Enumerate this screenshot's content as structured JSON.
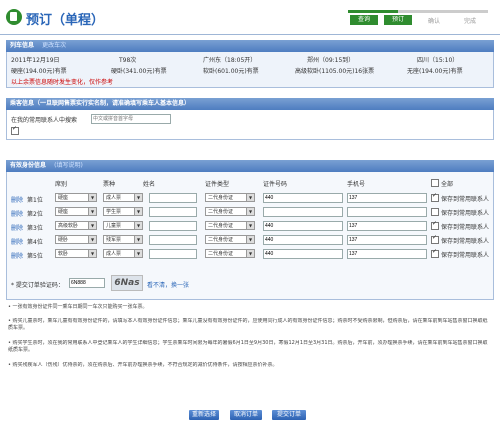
{
  "header": {
    "title": "预订（单程）",
    "steps": [
      "查询",
      "预订",
      "确认",
      "完成"
    ],
    "active_steps": 2
  },
  "train": {
    "section_title": "列车信息",
    "section_link": "更改车次",
    "date": "2011年12月19日",
    "train_no": "T98次",
    "from": "广州东（18:05开）",
    "via": "郑州（09:15到）",
    "to": "四川（15:10）",
    "seats": [
      "硬座(194.00元)有票",
      "硬卧(341.00元)有票",
      "软卧(601.00元)有票",
      "高级软卧(1105.00元)16张票",
      "无座(194.00元)有票"
    ],
    "note": "以上余票信息随时发生变化，仅作参考"
  },
  "search": {
    "section_title": "乘客信息（一旦联网售票实行实名制，请准确填写乘车人基本信息）",
    "label": "在我的常用联系人中搜索",
    "placeholder": "中文或拼音首字母"
  },
  "pass": {
    "section_title": "有效身份信息",
    "section_link": "(填写说明)",
    "columns": [
      "席别",
      "票种",
      "姓名",
      "证件类型",
      "证件号码",
      "手机号",
      "全部"
    ],
    "rows": [
      {
        "del": "删除",
        "pos": "第1位",
        "seat": "硬座",
        "ticket": "成人票",
        "idtype": "二代身份证",
        "idno": "440",
        "phone": "137",
        "save": "保存到常用联系人"
      },
      {
        "del": "删除",
        "pos": "第2位",
        "seat": "硬座",
        "ticket": "学生票",
        "idtype": "二代身份证",
        "idno": "",
        "phone": "",
        "save": "保存到常用联系人"
      },
      {
        "del": "删除",
        "pos": "第3位",
        "seat": "高级软卧",
        "ticket": "儿童票",
        "idtype": "二代身份证",
        "idno": "440",
        "phone": "137",
        "save": "保存到常用联系人"
      },
      {
        "del": "删除",
        "pos": "第4位",
        "seat": "硬卧",
        "ticket": "残军票",
        "idtype": "二代身份证",
        "idno": "440",
        "phone": "137",
        "save": "保存到常用联系人"
      },
      {
        "del": "删除",
        "pos": "第5位",
        "seat": "软卧",
        "ticket": "成人票",
        "idtype": "二代身份证",
        "idno": "440",
        "phone": "137",
        "save": "保存到常用联系人"
      }
    ],
    "captcha_label": "* 提交订单验证码：",
    "captcha_value": "6N888",
    "captcha_img": "6Nas",
    "captcha_link": "看不清，换一张"
  },
  "notes": [
    "• 一张有效身份证件同一乘车日期同一车次只能购买一张车票。",
    "• 购买儿童票时，乘车儿童有有效身份证件的，请填写本人有效身份证件信息；乘车儿童没有有效身份证件的，应使用同行成人的有效身份证件信息；购票时不受购票限制，但购票后，请在乘车前到车站售票窗口换取纸质车票。",
    "• 购买学生票时，须在我的常用联系人中登记乘车人的学生详细信息；学生票乘车时间限为每年的暑假6月1日至9月30日，寒假12月1日至3月31日。购票后，开车前，须办理换票手续，请在乘车前到车站售票窗口换取纸质车票。",
    "• 购买残疾军人（伤残）优待票的，须在购票后、开车前办理换票手续，不符合规定的减价优待条件，请按相应票价补票。"
  ],
  "buttons": {
    "modify": "重新选择",
    "cancel": "取消订单",
    "submit": "提交订单"
  }
}
